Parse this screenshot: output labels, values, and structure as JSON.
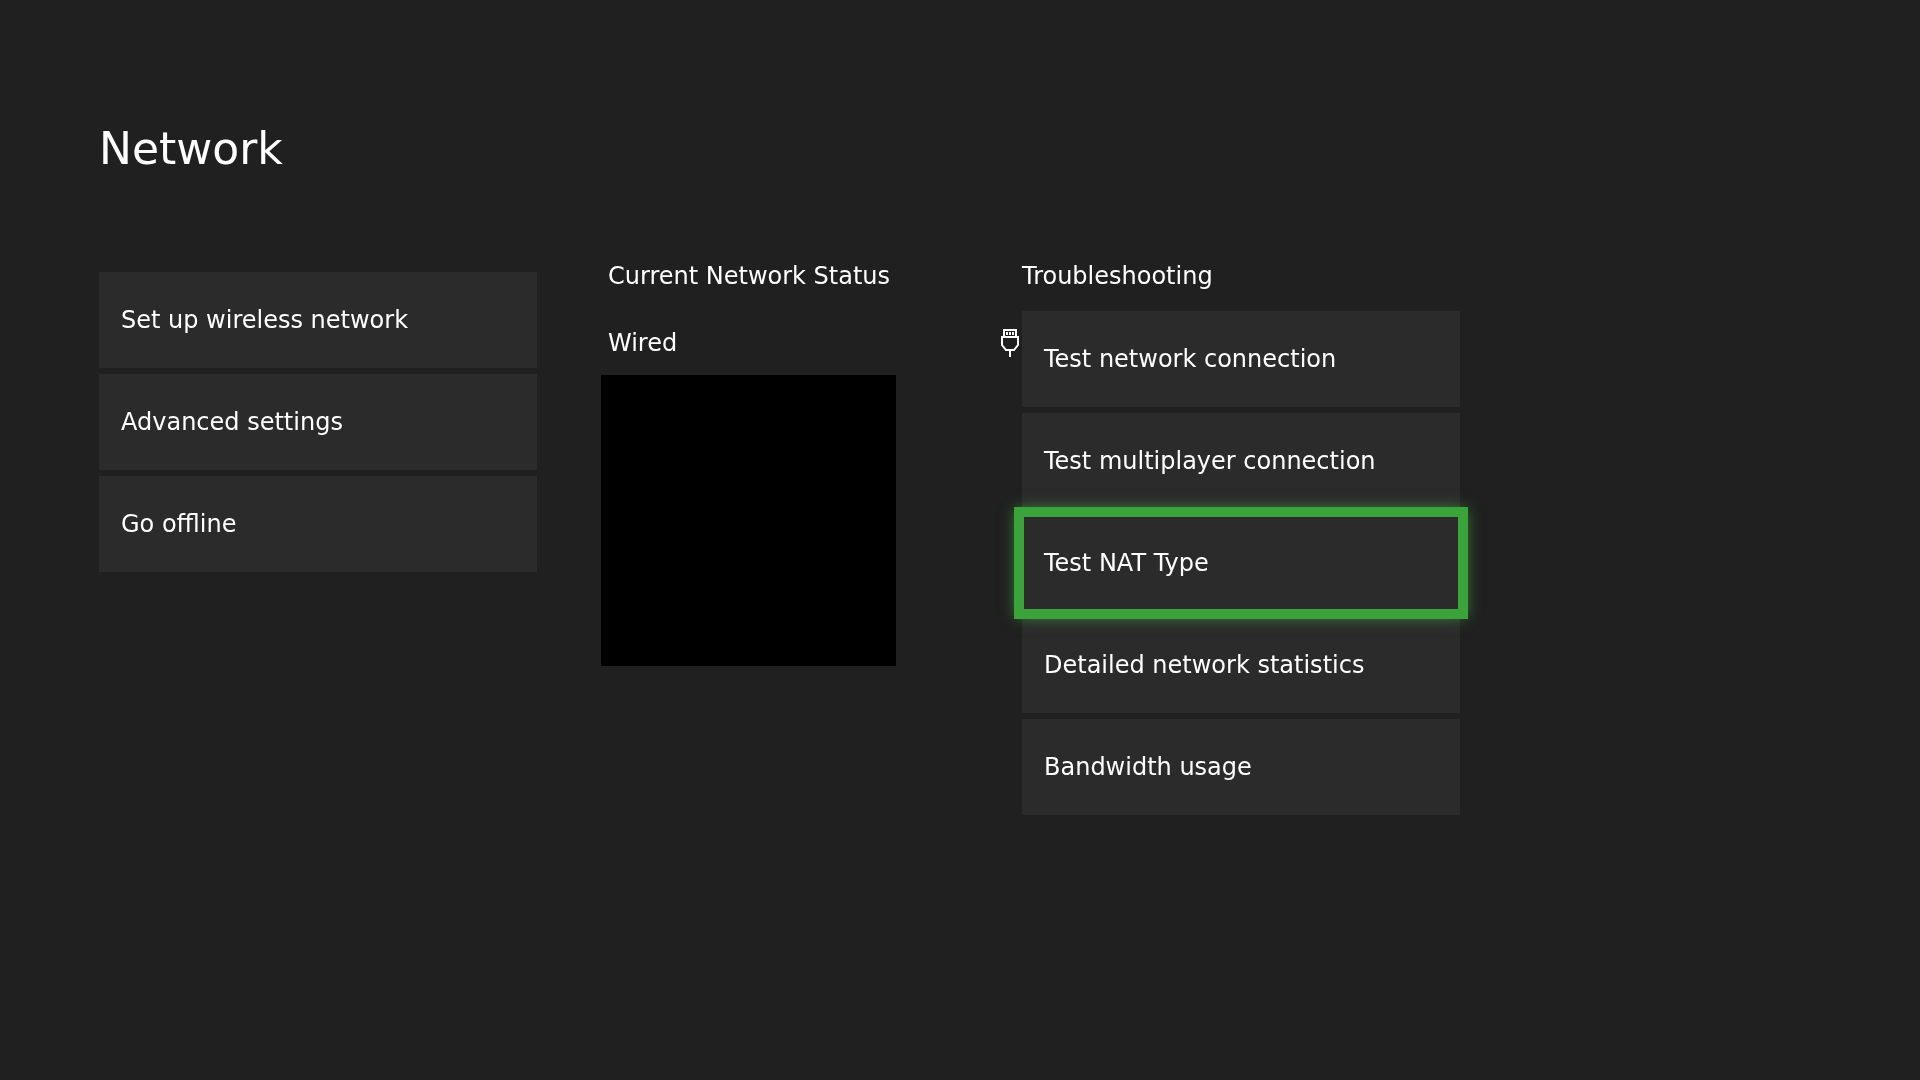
{
  "title": "Network",
  "menu": [
    {
      "label": "Set up wireless network",
      "selected": false
    },
    {
      "label": "Advanced settings",
      "selected": false
    },
    {
      "label": "Go offline",
      "selected": false
    }
  ],
  "status": {
    "heading": "Current Network Status",
    "connection": "Wired"
  },
  "troubleshooting": {
    "heading": "Troubleshooting",
    "items": [
      {
        "label": "Test network connection",
        "selected": false
      },
      {
        "label": "Test multiplayer connection",
        "selected": false
      },
      {
        "label": "Test NAT Type",
        "selected": true
      },
      {
        "label": "Detailed network statistics",
        "selected": false
      },
      {
        "label": "Bandwidth usage",
        "selected": false
      }
    ]
  }
}
